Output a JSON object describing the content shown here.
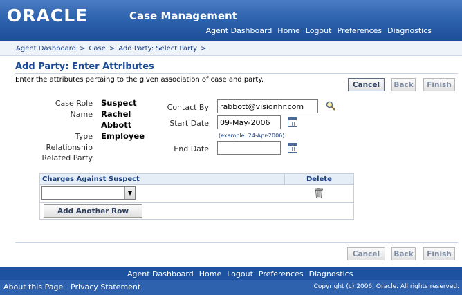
{
  "header": {
    "logo": "ORACLE",
    "app_title": "Case Management",
    "nav": [
      "Agent Dashboard",
      "Home",
      "Logout",
      "Preferences",
      "Diagnostics"
    ]
  },
  "breadcrumb": [
    "Agent Dashboard",
    "Case",
    "Add Party: Select Party"
  ],
  "breadcrumb_separator": ">",
  "page": {
    "title": "Add Party: Enter Attributes",
    "instructions": "Enter the attributes pertaing to the given association of case and party."
  },
  "buttons": {
    "cancel": "Cancel",
    "back": "Back",
    "finish": "Finish",
    "add_row": "Add Another Row"
  },
  "form": {
    "case_role_label": "Case Role",
    "case_role_value": "Suspect",
    "name_label": "Name",
    "name_first": "Rachel",
    "name_last": "Abbott",
    "type_label": "Type",
    "type_value": "Employee",
    "relationship_label": "Relationship",
    "related_party_label": "Related Party",
    "contact_by_label": "Contact By",
    "contact_by_value": "rabbott@visionhr.com",
    "start_date_label": "Start Date",
    "start_date_value": "09-May-2006",
    "date_hint": "(example: 24-Apr-2006)",
    "end_date_label": "End Date",
    "end_date_value": ""
  },
  "table": {
    "col_charges": "Charges Against Suspect",
    "col_delete": "Delete",
    "rows": [
      {
        "charge": ""
      }
    ]
  },
  "footer": {
    "nav": [
      "Agent Dashboard",
      "Home",
      "Logout",
      "Preferences",
      "Diagnostics"
    ],
    "about": "About this Page",
    "privacy": "Privacy Statement",
    "copyright": "Copyright (c) 2006, Oracle. All rights reserved."
  },
  "icons": {
    "search": "search-icon",
    "calendar": "calendar-icon",
    "trash": "trash-icon"
  },
  "colors": {
    "header_blue": "#2e63ad",
    "title_blue": "#1a4b96",
    "table_header_bg": "#e5edf6"
  }
}
